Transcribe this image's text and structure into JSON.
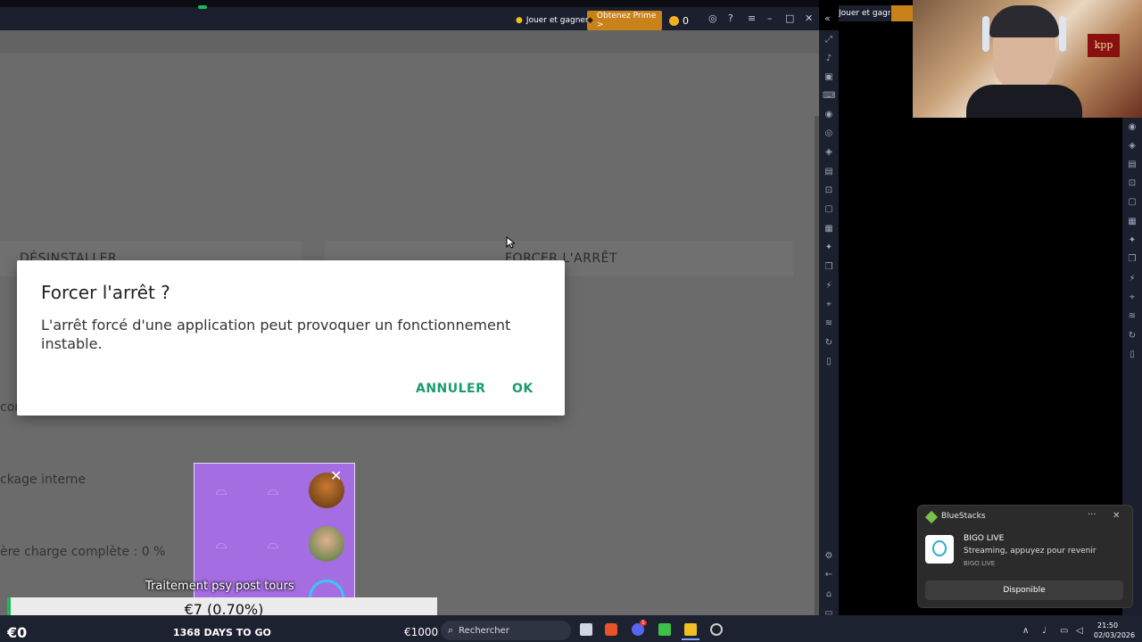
{
  "topbar": {
    "play_earn": "Jouer et gagner",
    "prime": "Obtenez Prime >",
    "coins": "0",
    "right_overflow": "Jouer et gagner"
  },
  "app_screen": {
    "uninstall": "DÉSINSTALLER",
    "force_stop": "FORCER L'ARRÊT",
    "partial_text_1": "con",
    "partial_text_2": "ckage interne",
    "partial_text_3": "ère charge complète : 0 %"
  },
  "dialog": {
    "title": "Forcer l'arrêt ?",
    "message": "L'arrêt forcé d'une application peut provoquer un fonctionnement instable.",
    "cancel": "ANNULER",
    "ok": "OK"
  },
  "overlay": {
    "caption": "Traitement psy post tours",
    "donation": "€7 (0.70%)",
    "balance": "€0",
    "days": "1368 DAYS TO GO",
    "goal": "€1000",
    "close": "✕"
  },
  "notification": {
    "app": "BlueStacks",
    "title": "BIGO LIVE",
    "body": "Streaming, appuyez pour revenir",
    "source": "BIGO LIVE",
    "action": "Disponible",
    "more": "···",
    "close": "✕"
  },
  "taskbar": {
    "search_placeholder": "Rechercher",
    "time": "21:50",
    "date": "02/03/2026",
    "discord_badge": "5"
  },
  "webcam": {
    "hat_text": "kpp"
  },
  "icons": {
    "search": "search-icon",
    "gear": "gear-icon",
    "back": "back-icon",
    "home": "home-icon"
  },
  "colors": {
    "accent_green": "#1a9b6e",
    "prime_orange": "#f0a020",
    "popup_purple": "#a56de2"
  }
}
